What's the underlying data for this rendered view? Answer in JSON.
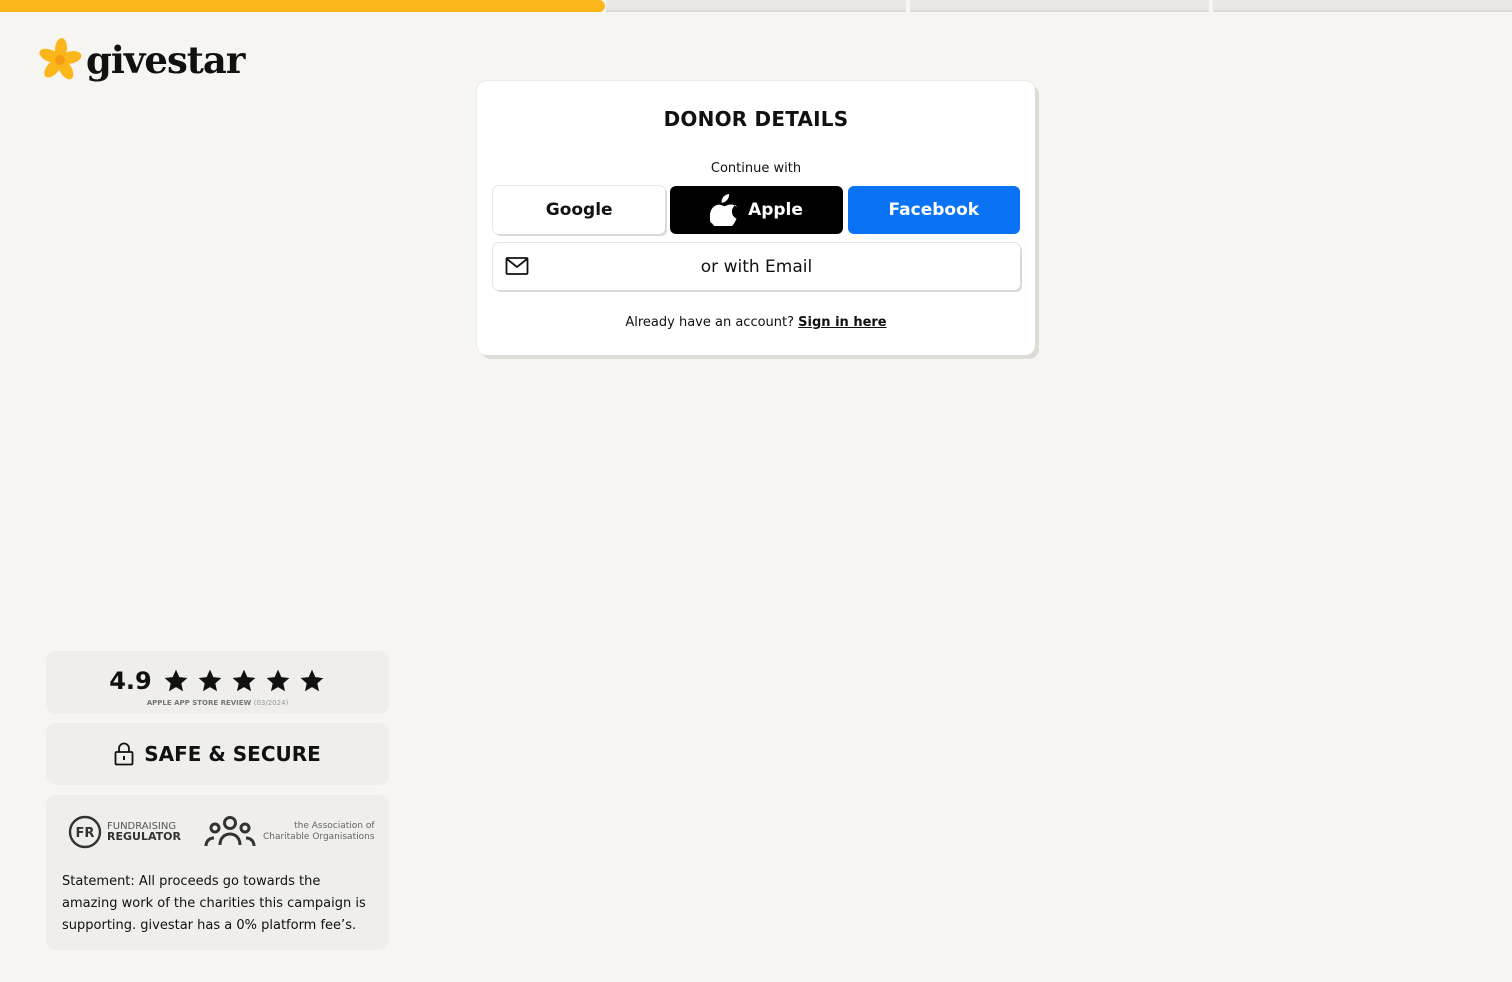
{
  "progress": {
    "segments": 5,
    "completed_fraction": 0.4,
    "accent_color": "#fbb71a"
  },
  "brand": {
    "name": "givestar",
    "logo_icon": "star-flower-icon",
    "logo_color": "#fbb71a"
  },
  "donor_card": {
    "title": "DONOR DETAILS",
    "continue_label": "Continue with",
    "buttons": {
      "google": {
        "label": "Google",
        "icon": "google-icon"
      },
      "apple": {
        "label": "Apple",
        "icon": "apple-icon"
      },
      "facebook": {
        "label": "Facebook",
        "icon": "facebook-icon",
        "color": "#0a73f5"
      }
    },
    "email_button": {
      "label": "or with Email",
      "icon": "mail-icon"
    },
    "signin_prompt": "Already have an account?",
    "signin_link": "Sign in here"
  },
  "rating": {
    "value": "4.9",
    "stars": 4.9,
    "source": "APPLE APP STORE REVIEW",
    "date": "(03/2024)"
  },
  "security": {
    "label": "SAFE & SECURE",
    "icon": "lock-icon"
  },
  "trust": {
    "fundraising_regulator": {
      "line1": "FUNDRAISING",
      "line2": "REGULATOR",
      "badge": "FR"
    },
    "aco": {
      "line1": "the Association of",
      "line2": "Charitable Organisations"
    },
    "statement": "Statement: All proceeds go towards the amazing work of the charities this campaign is supporting. givestar has a 0% platform fee’s."
  }
}
